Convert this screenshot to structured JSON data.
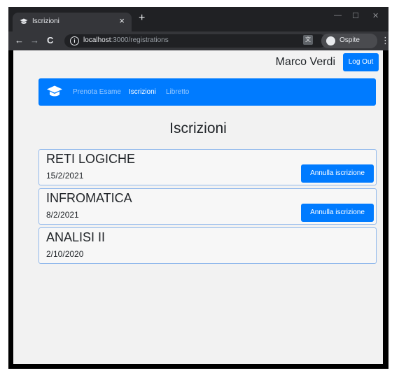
{
  "browser": {
    "tab_title": "Iscrizioni",
    "tab_close": "×",
    "new_tab": "+",
    "back": "←",
    "forward": "→",
    "reload": "C",
    "info": "i",
    "url_host": "localhost",
    "url_path": ":3000/registrations",
    "translate": "文",
    "profile_label": "Ospite",
    "menu": "⋮",
    "minimize": "—",
    "maximize": "☐",
    "close": "✕"
  },
  "header": {
    "username": "Marco Verdi",
    "logout_label": "Log Out"
  },
  "navbar": {
    "links": [
      "Prenota Esame",
      "Iscrizioni",
      "Libretto"
    ],
    "active_index": 1
  },
  "main": {
    "title": "Iscrizioni",
    "registrations": [
      {
        "course": "RETI LOGICHE",
        "date": "15/2/2021",
        "action": "Annulla iscrizione"
      },
      {
        "course": "INFROMATICA",
        "date": "8/2/2021",
        "action": "Annulla iscrizione"
      },
      {
        "course": "ANALISI II",
        "date": "2/10/2020",
        "action": ""
      }
    ]
  },
  "colors": {
    "primary": "#007bff",
    "card_border": "#90b8ec",
    "page_bg": "#f2f2f2"
  }
}
